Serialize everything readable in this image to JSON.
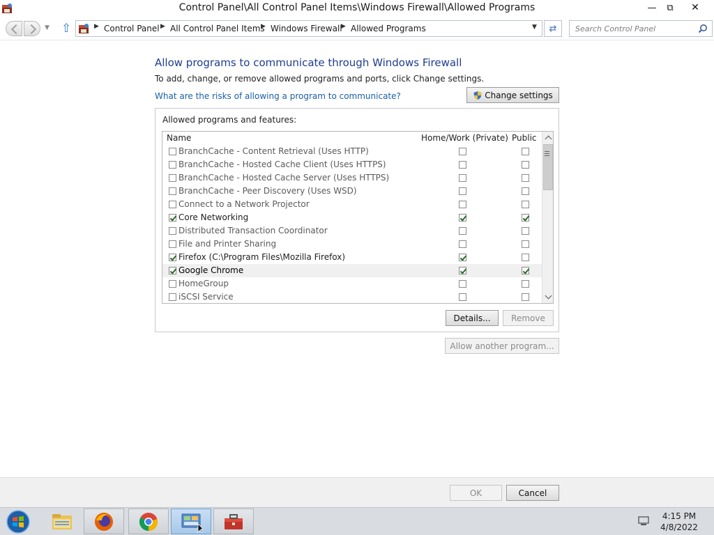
{
  "window": {
    "title": "Control Panel\\All Control Panel Items\\Windows Firewall\\Allowed Programs",
    "minimize_glyph": "—",
    "restore_glyph": "⧉",
    "close_glyph": "✕"
  },
  "address_bar": {
    "breadcrumbs": [
      "Control Panel",
      "All Control Panel Items",
      "Windows Firewall",
      "Allowed Programs"
    ],
    "separator_glyph": "▶",
    "dropdown_glyph": "▼",
    "refresh_glyph": "⇄"
  },
  "search": {
    "placeholder": "Search Control Panel"
  },
  "content": {
    "heading": "Allow programs to communicate through Windows Firewall",
    "subtext": "To add, change, or remove allowed programs and ports, click Change settings.",
    "risk_link": "What are the risks of allowing a program to communicate?",
    "change_settings_label": "Change settings"
  },
  "allowed_list": {
    "group_label": "Allowed programs and features:",
    "columns": {
      "name": "Name",
      "home": "Home/Work (Private)",
      "public": "Public"
    },
    "rows": [
      {
        "name": "BranchCache - Content Retrieval (Uses HTTP)",
        "enabled": false,
        "home": false,
        "public": false,
        "selected": false
      },
      {
        "name": "BranchCache - Hosted Cache Client (Uses HTTPS)",
        "enabled": false,
        "home": false,
        "public": false,
        "selected": false
      },
      {
        "name": "BranchCache - Hosted Cache Server (Uses HTTPS)",
        "enabled": false,
        "home": false,
        "public": false,
        "selected": false
      },
      {
        "name": "BranchCache - Peer Discovery (Uses WSD)",
        "enabled": false,
        "home": false,
        "public": false,
        "selected": false
      },
      {
        "name": "Connect to a Network Projector",
        "enabled": false,
        "home": false,
        "public": false,
        "selected": false
      },
      {
        "name": "Core Networking",
        "enabled": true,
        "home": true,
        "public": true,
        "selected": false
      },
      {
        "name": "Distributed Transaction Coordinator",
        "enabled": false,
        "home": false,
        "public": false,
        "selected": false
      },
      {
        "name": "File and Printer Sharing",
        "enabled": false,
        "home": false,
        "public": false,
        "selected": false
      },
      {
        "name": "Firefox (C:\\Program Files\\Mozilla Firefox)",
        "enabled": true,
        "home": true,
        "public": false,
        "selected": false
      },
      {
        "name": "Google Chrome",
        "enabled": true,
        "home": true,
        "public": true,
        "selected": true
      },
      {
        "name": "HomeGroup",
        "enabled": false,
        "home": false,
        "public": false,
        "selected": false
      },
      {
        "name": "iSCSI Service",
        "enabled": false,
        "home": false,
        "public": false,
        "selected": false
      }
    ],
    "details_label": "Details...",
    "remove_label": "Remove"
  },
  "allow_another_label": "Allow another program...",
  "footer": {
    "ok_label": "OK",
    "cancel_label": "Cancel"
  },
  "taskbar": {
    "items": [
      "windows-start-icon",
      "file-explorer-icon",
      "firefox-icon",
      "chrome-icon",
      "control-panel-icon",
      "toolbox-icon"
    ],
    "time": "4:15 PM",
    "date": "4/8/2022"
  },
  "colors": {
    "heading": "#1e3d8f",
    "link": "#1a5fa8",
    "check": "#2a6a2a",
    "selected_row": "#f0f0f0"
  }
}
